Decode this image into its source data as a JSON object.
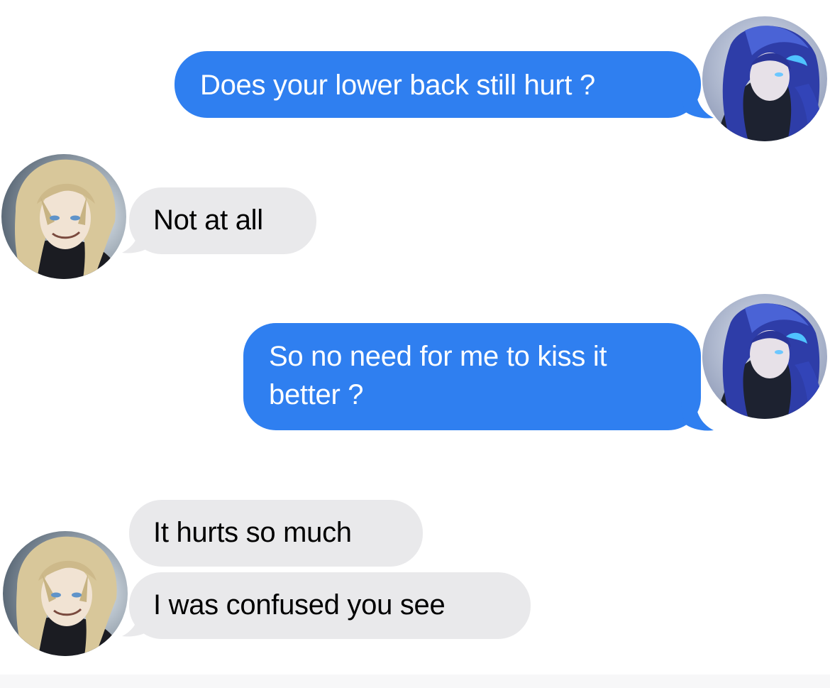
{
  "messages": [
    {
      "id": "m1",
      "side": "sent",
      "text": "Does your lower back still hurt ?"
    },
    {
      "id": "m2",
      "side": "received",
      "text": "Not at all"
    },
    {
      "id": "m3",
      "side": "sent",
      "text": "So no need for me to kiss it\nbetter ?"
    },
    {
      "id": "m4",
      "side": "received",
      "text": "It hurts so much"
    },
    {
      "id": "m5",
      "side": "received",
      "text": "I was confused you see"
    }
  ],
  "colors": {
    "sent_bubble": "#2f7ff0",
    "received_bubble": "#e9e9eb",
    "sent_text": "#ffffff",
    "received_text": "#000000"
  },
  "avatars": {
    "sender": "blue-haired-character-avatar",
    "receiver": "blonde-character-avatar"
  }
}
